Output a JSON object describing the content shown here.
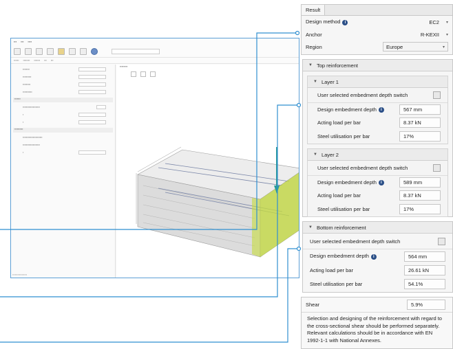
{
  "result_panel": {
    "tab": "Result",
    "design_method": {
      "label": "Design method",
      "value": "EC2"
    },
    "anchor": {
      "label": "Anchor",
      "value": "R-KEXII"
    },
    "region": {
      "label": "Region",
      "value": "Europe"
    }
  },
  "top_reinforcement": {
    "title": "Top reinforcement",
    "layers": [
      {
        "title": "Layer 1",
        "switch_label": "User selected embedment depth switch",
        "depth_label": "Design embedment depth",
        "depth": "567 mm",
        "load_label": "Acting load per bar",
        "load": "8.37 kN",
        "util_label": "Steel utilisation per bar",
        "util": "17%"
      },
      {
        "title": "Layer 2",
        "switch_label": "User selected embedment depth switch",
        "depth_label": "Design embedment depth",
        "depth": "589 mm",
        "load_label": "Acting load per bar",
        "load": "8.37 kN",
        "util_label": "Steel utilisation per bar",
        "util": "17%"
      }
    ]
  },
  "bottom_reinforcement": {
    "title": "Bottom reinforcement",
    "switch_label": "User selected embedment depth switch",
    "depth_label": "Design embedment depth",
    "depth": "564 mm",
    "load_label": "Acting load per bar",
    "load": "26.61 kN",
    "util_label": "Steel utilisation per bar",
    "util": "54.1%"
  },
  "shear": {
    "label": "Shear",
    "value": "5.9%",
    "note": "Selection and designing of the reinforcement with regard to the cross-sectional shear should be performed separately. Relevant calculations should be in accordance with EN 1992-1-1 with National Annexes."
  },
  "colors": {
    "accent": "#2f8fd0",
    "info": "#2b4f87",
    "rebar": "#c6dc3e",
    "anchor": "#2a9a9a"
  }
}
